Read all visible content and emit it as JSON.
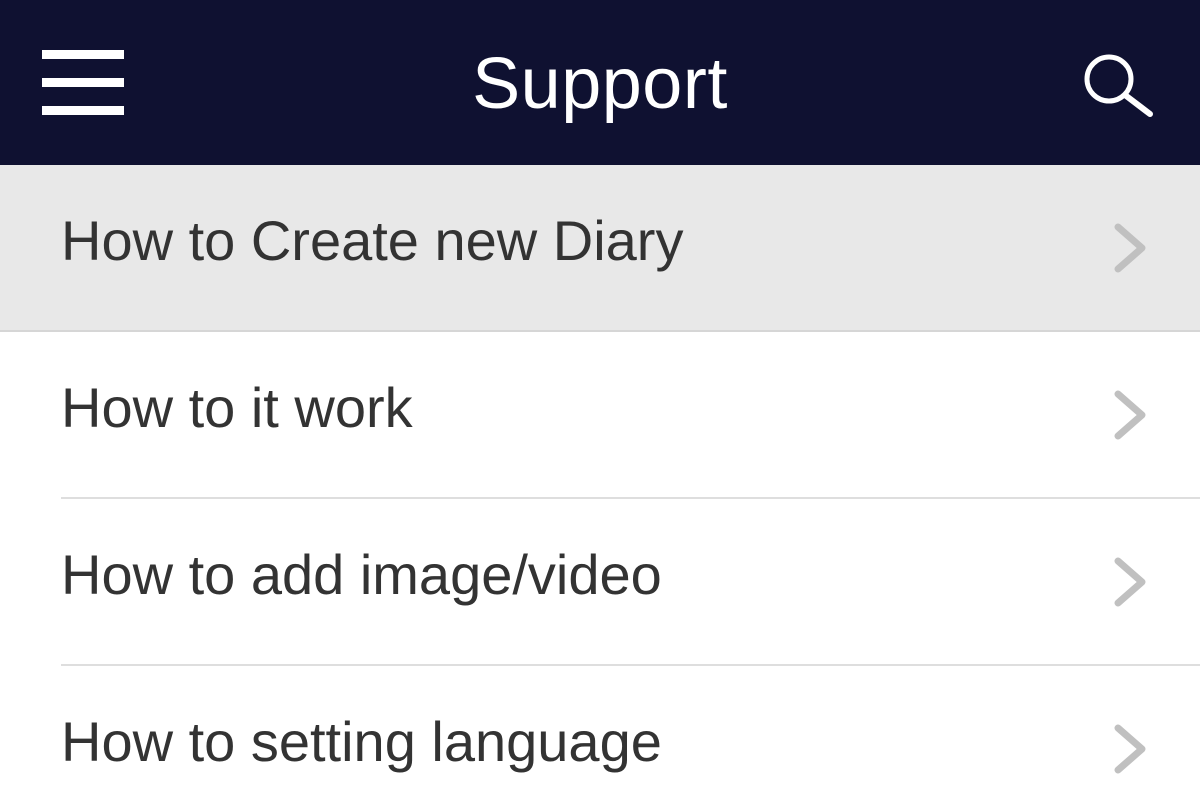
{
  "header": {
    "title": "Support",
    "background_color": "#0f1131",
    "menu_icon": "hamburger-menu-icon",
    "search_icon": "search-icon"
  },
  "list": {
    "items": [
      {
        "label": "How to Create new Diary",
        "selected": true
      },
      {
        "label": "How to it work",
        "selected": false
      },
      {
        "label": "How to add image/video",
        "selected": false
      },
      {
        "label": "How to setting language",
        "selected": false
      }
    ],
    "item_icon": "chevron-right-icon",
    "selected_background": "#e8e8e8"
  }
}
